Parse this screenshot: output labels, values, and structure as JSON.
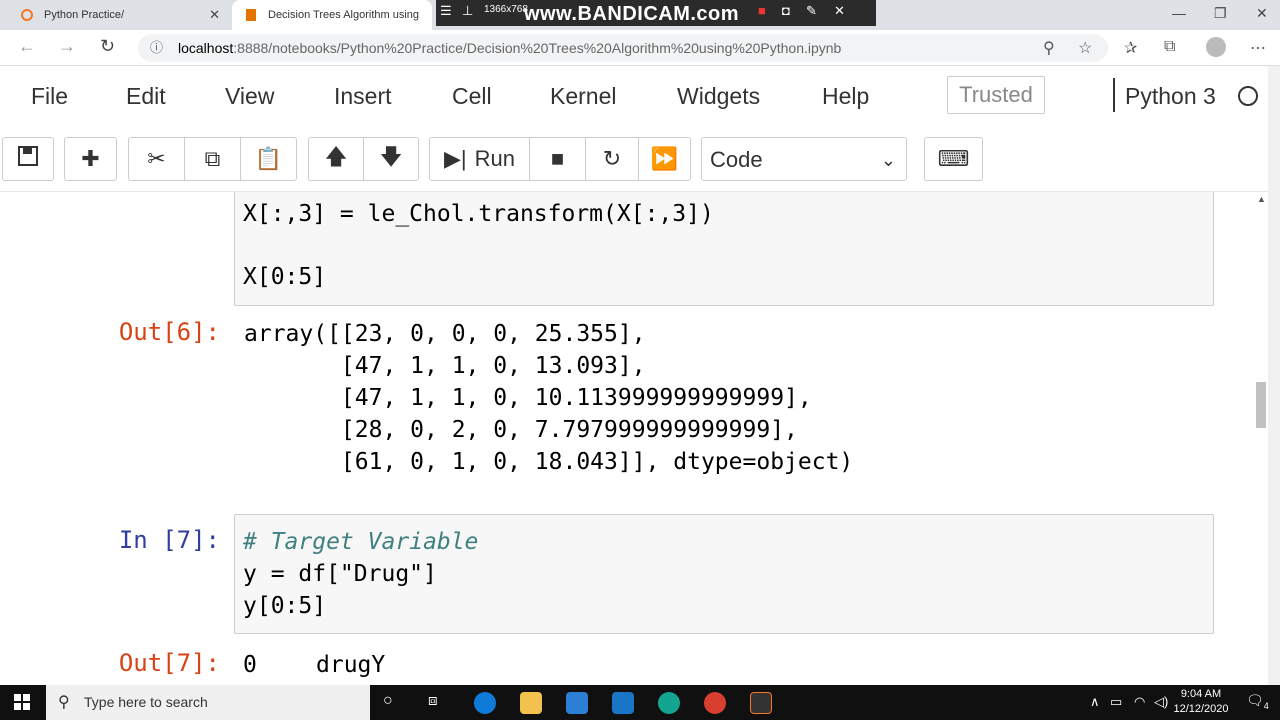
{
  "browser": {
    "tabs": [
      {
        "title": "Python Practice/"
      },
      {
        "title": "Decision Trees Algorithm using"
      }
    ],
    "url_host": "localhost",
    "url_rest": ":8888/notebooks/Python%20Practice/Decision%20Trees%20Algorithm%20using%20Python.ipynb",
    "recorder": {
      "resolution": "1366x768",
      "brand": "www.BANDICAM.com"
    }
  },
  "menubar": {
    "items": [
      "File",
      "Edit",
      "View",
      "Insert",
      "Cell",
      "Kernel",
      "Widgets",
      "Help"
    ],
    "trusted": "Trusted",
    "kernel": "Python 3"
  },
  "toolbar": {
    "run_label": "Run",
    "cell_type": "Code"
  },
  "cells": {
    "cell6_in_line1": "X[:,3] = le_Chol.transform(X[:,3])",
    "cell6_in_line2": "X[0:5]",
    "out6_prompt": "Out[6]:",
    "out6_lines": [
      "array([[23, 0, 0, 0, 25.355],",
      "       [47, 1, 1, 0, 13.093],",
      "       [47, 1, 1, 0, 10.113999999999999],",
      "       [28, 0, 2, 0, 7.797999999999999],",
      "       [61, 0, 1, 0, 18.043]], dtype=object)"
    ],
    "in7_prompt": "In [7]:",
    "in7_comment": "# Target Variable",
    "in7_line2": "y = df[\"Drug\"]",
    "in7_line3": "y[0:5]",
    "out7_prompt": "Out[7]:",
    "out7_index": "0",
    "out7_value": "drugY"
  },
  "taskbar": {
    "search_placeholder": "Type here to search",
    "time": "9:04 AM",
    "date": "12/12/2020",
    "notifications": "4"
  }
}
